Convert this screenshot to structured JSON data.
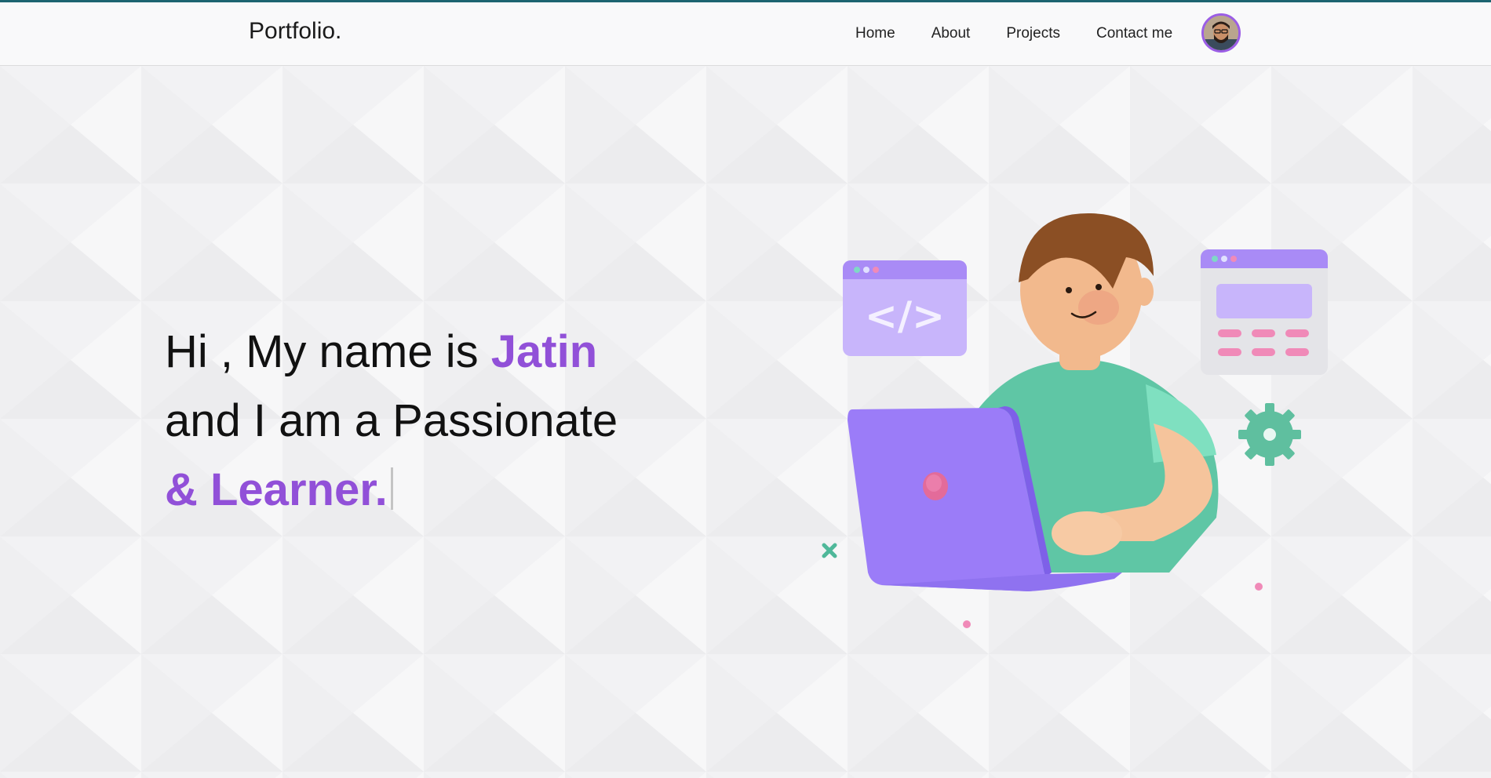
{
  "navbar": {
    "brand": "Portfolio.",
    "links": [
      "Home",
      "About",
      "Projects",
      "Contact me"
    ]
  },
  "hero": {
    "line1_prefix": "Hi , My name is ",
    "line1_name": "Jatin",
    "line2": "and I am a Passionate",
    "line3": "& Learner."
  },
  "colors": {
    "accent": "#9150d8",
    "top_bar": "#1d6470",
    "laptop": "#9b7cf8",
    "shirt": "#5fc6a5",
    "window_header": "#a98bf6",
    "pink": "#f08ab8"
  },
  "icons": [
    "profile-avatar",
    "code-window-icon",
    "ui-window-icon",
    "gear-icon",
    "close-x-icon"
  ]
}
